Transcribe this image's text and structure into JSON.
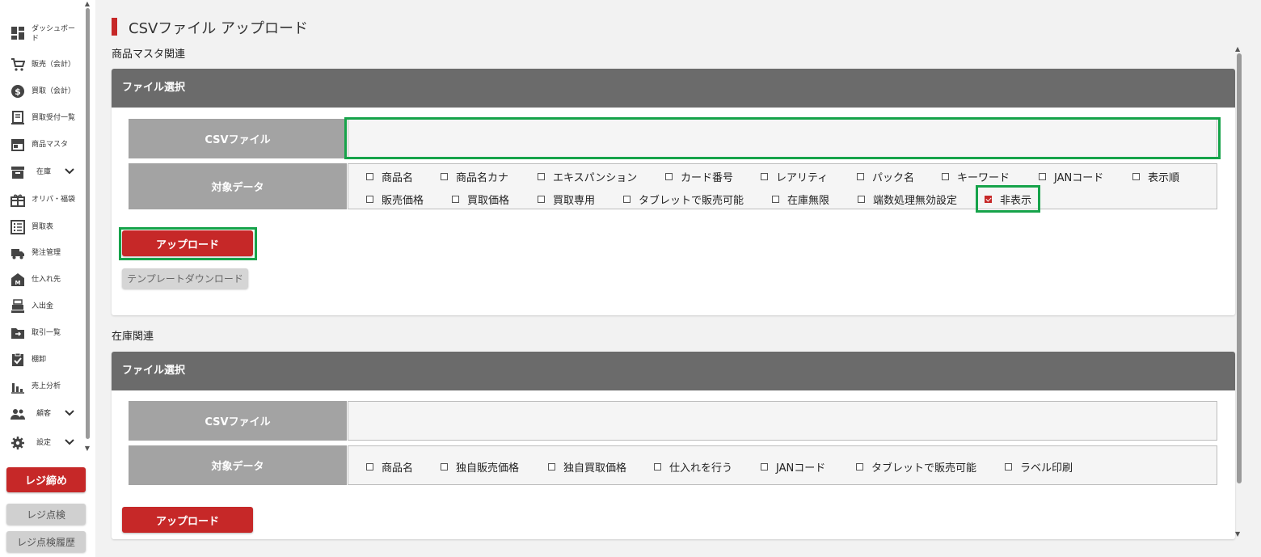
{
  "sidebar": {
    "items": [
      {
        "label": "ダッシュボード",
        "icon": "dashboard-icon"
      },
      {
        "label": "販売（会計）",
        "icon": "cart-icon"
      },
      {
        "label": "買取（会計）",
        "icon": "dollar-icon"
      },
      {
        "label": "買取受付一覧",
        "icon": "receipt-icon"
      },
      {
        "label": "商品マスタ",
        "icon": "store-icon"
      },
      {
        "label": "在庫",
        "icon": "archive-icon"
      },
      {
        "label": "オリパ・福袋",
        "icon": "gift-icon"
      },
      {
        "label": "買取表",
        "icon": "list-icon"
      },
      {
        "label": "発注管理",
        "icon": "truck-icon"
      },
      {
        "label": "仕入れ先",
        "icon": "warehouse-icon"
      },
      {
        "label": "入出金",
        "icon": "register-icon"
      },
      {
        "label": "取引一覧",
        "icon": "folder-arrow-icon"
      },
      {
        "label": "棚卸",
        "icon": "clipboard-check-icon"
      },
      {
        "label": "売上分析",
        "icon": "bar-chart-icon"
      },
      {
        "label": "顧客",
        "icon": "people-icon"
      },
      {
        "label": "設定",
        "icon": "gear-icon"
      }
    ],
    "close_register_label": "レジ締め",
    "register_check_label": "レジ点検",
    "register_check_history_label": "レジ点検履歴"
  },
  "main": {
    "title": "CSVファイル アップロード",
    "section1": {
      "label": "商品マスタ関連",
      "header": "ファイル選択",
      "file_label": "CSVファイル",
      "data_label": "対象データ",
      "options_row1": [
        {
          "label": "商品名",
          "checked": false
        },
        {
          "label": "商品名カナ",
          "checked": false
        },
        {
          "label": "エキスパンション",
          "checked": false
        },
        {
          "label": "カード番号",
          "checked": false
        },
        {
          "label": "レアリティ",
          "checked": false
        },
        {
          "label": "パック名",
          "checked": false
        },
        {
          "label": "キーワード",
          "checked": false
        },
        {
          "label": "JANコード",
          "checked": false
        },
        {
          "label": "表示順",
          "checked": false
        }
      ],
      "options_row2": [
        {
          "label": "販売価格",
          "checked": false
        },
        {
          "label": "買取価格",
          "checked": false
        },
        {
          "label": "買取専用",
          "checked": false
        },
        {
          "label": "タブレットで販売可能",
          "checked": false
        },
        {
          "label": "在庫無限",
          "checked": false
        },
        {
          "label": "端数処理無効設定",
          "checked": false
        },
        {
          "label": "非表示",
          "checked": true
        }
      ],
      "upload_label": "アップロード",
      "template_label": "テンプレートダウンロード"
    },
    "section2": {
      "label": "在庫関連",
      "header": "ファイル選択",
      "file_label": "CSVファイル",
      "data_label": "対象データ",
      "options": [
        {
          "label": "商品名",
          "checked": false
        },
        {
          "label": "独自販売価格",
          "checked": false
        },
        {
          "label": "独自買取価格",
          "checked": false
        },
        {
          "label": "仕入れを行う",
          "checked": false
        },
        {
          "label": "JANコード",
          "checked": false
        },
        {
          "label": "タブレットで販売可能",
          "checked": false
        },
        {
          "label": "ラベル印刷",
          "checked": false
        }
      ],
      "upload_label": "アップロード"
    }
  },
  "colors": {
    "accent_red": "#c62828",
    "header_gray": "#6b6b6b",
    "label_gray": "#a3a3a3",
    "highlight_green": "#16a34a"
  }
}
